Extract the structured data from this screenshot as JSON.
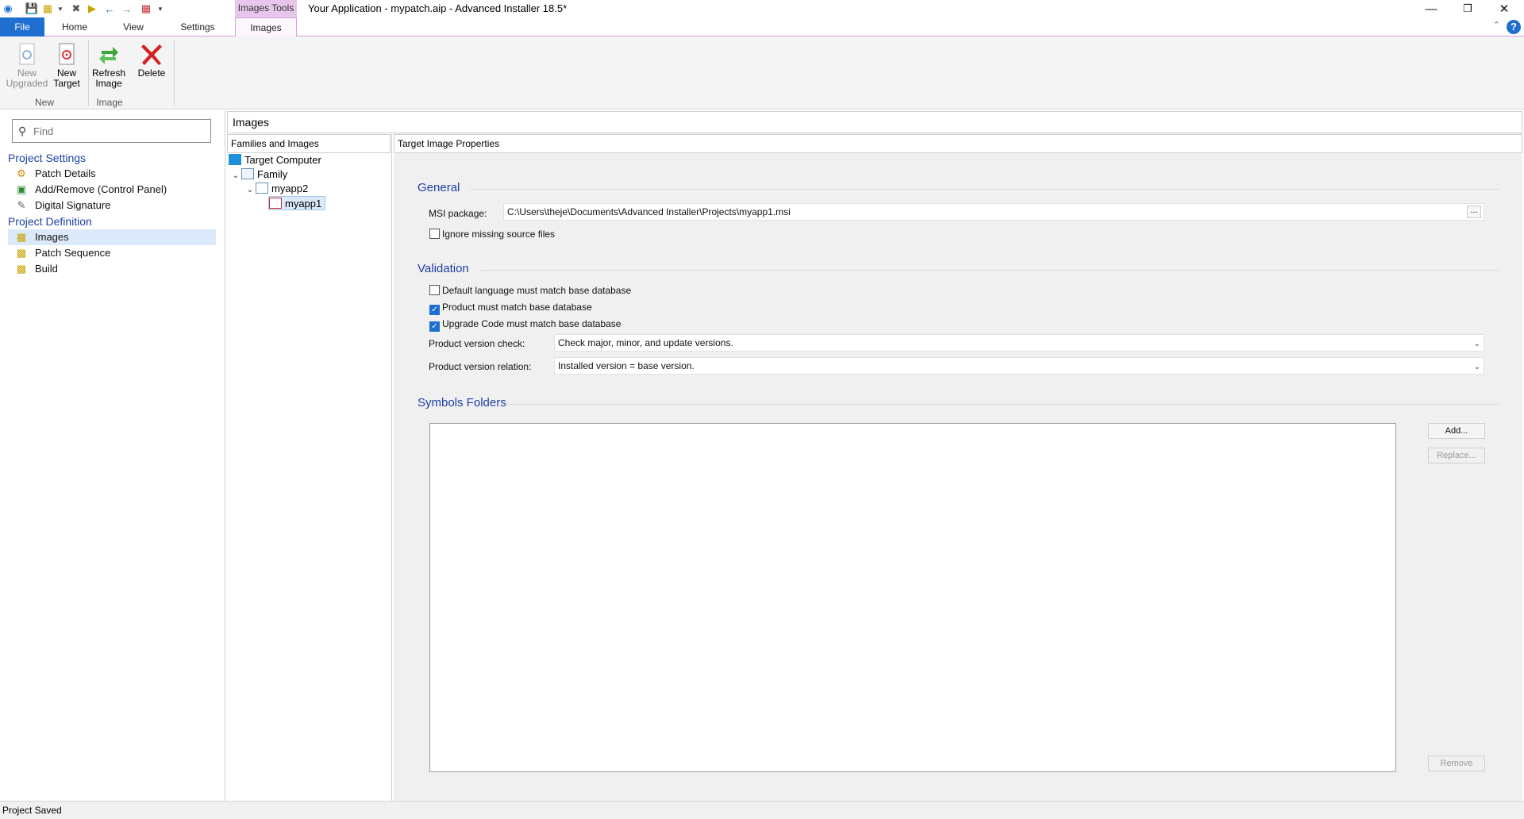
{
  "titlebar": {
    "title": "Your Application - mypatch.aip - Advanced Installer 18.5*",
    "context_tab_group": "Images Tools",
    "minimize_icon": "minimize-icon",
    "restore_icon": "restore-icon",
    "close_icon": "close-icon"
  },
  "tabs": {
    "file": "File",
    "home": "Home",
    "view": "View",
    "settings": "Settings",
    "images": "Images"
  },
  "ribbon": {
    "new_upgraded": "New\nUpgraded",
    "new_target": "New\nTarget",
    "refresh_image": "Refresh\nImage",
    "delete": "Delete",
    "group_new": "New",
    "group_image": "Image"
  },
  "sidebar": {
    "find_placeholder": "Find",
    "section_settings": "Project Settings",
    "section_definition": "Project Definition",
    "items": {
      "patch_details": "Patch Details",
      "add_remove": "Add/Remove (Control Panel)",
      "digital_signature": "Digital Signature",
      "images": "Images",
      "patch_sequence": "Patch Sequence",
      "build": "Build"
    }
  },
  "panel": {
    "title": "Images",
    "families_header": "Families and Images",
    "properties_header": "Target Image Properties"
  },
  "tree": {
    "target_computer": "Target Computer",
    "family": "Family",
    "myapp2": "myapp2",
    "myapp1": "myapp1"
  },
  "general": {
    "title": "General",
    "msi_label": "MSI package:",
    "msi_value": "C:\\Users\\theje\\Documents\\Advanced Installer\\Projects\\myapp1.msi",
    "browse_label": "...",
    "ignore_missing": "Ignore missing source files",
    "ignore_missing_checked": false
  },
  "validation": {
    "title": "Validation",
    "default_language": "Default language must match base database",
    "default_language_checked": false,
    "product_match": "Product must match base database",
    "product_match_checked": true,
    "upgrade_code": "Upgrade Code must match base database",
    "upgrade_code_checked": true,
    "version_check_label": "Product version check:",
    "version_check_value": "Check major, minor, and update versions.",
    "version_relation_label": "Product version relation:",
    "version_relation_value": "Installed version = base version."
  },
  "symbols": {
    "title": "Symbols Folders",
    "add": "Add...",
    "replace": "Replace...",
    "remove": "Remove"
  },
  "status": {
    "text": "Project Saved"
  },
  "colors": {
    "accent": "#1e6fd0",
    "section_title": "#1c3fa6",
    "context_tab": "#e8c6ec",
    "selected_nav": "#dbe9fb"
  }
}
